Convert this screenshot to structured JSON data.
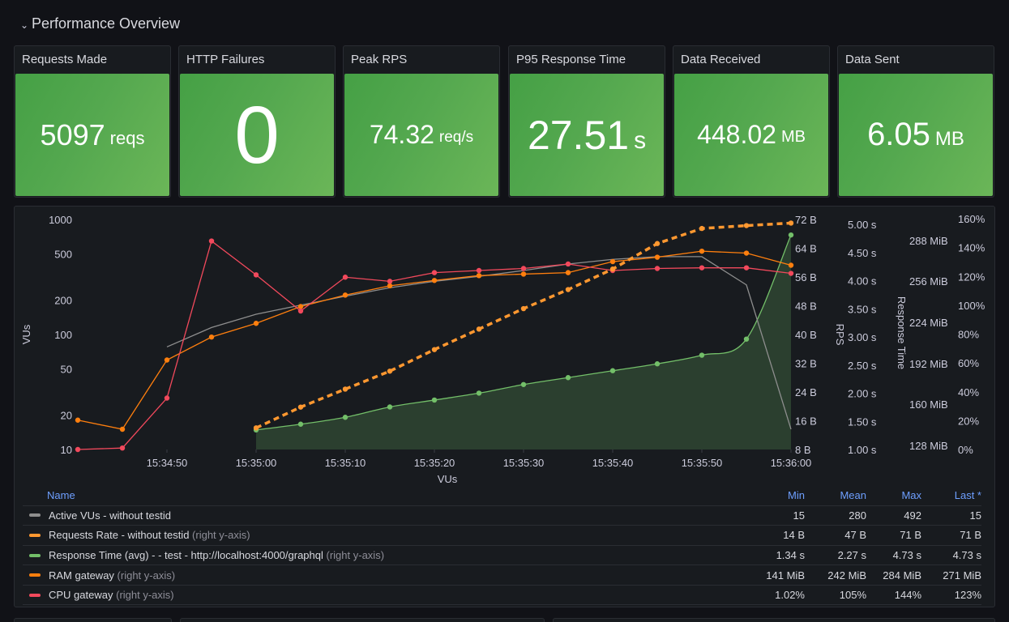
{
  "row": {
    "title": "Performance Overview",
    "collapse_icon": "chevron-down-icon"
  },
  "stats": [
    {
      "title": "Requests Made",
      "value": "5097",
      "unit": "reqs",
      "color": "#56a64b"
    },
    {
      "title": "HTTP Failures",
      "value": "0",
      "unit": "",
      "color": "#56a64b"
    },
    {
      "title": "Peak RPS",
      "value": "74.32",
      "unit": "req/s",
      "color": "#56a64b"
    },
    {
      "title": "P95 Response Time",
      "value": "27.51",
      "unit": "s",
      "color": "#56a64b"
    },
    {
      "title": "Data Received",
      "value": "448.02",
      "unit": "MB",
      "color": "#56a64b"
    },
    {
      "title": "Data Sent",
      "value": "6.05",
      "unit": "MB",
      "color": "#56a64b"
    }
  ],
  "chart_data": {
    "type": "line",
    "title": "",
    "xlabel": "VUs",
    "x_ticks": [
      "15:34:50",
      "15:35:00",
      "15:35:10",
      "15:35:20",
      "15:35:30",
      "15:35:40",
      "15:35:50",
      "15:36:00"
    ],
    "x": [
      "15:34:40",
      "15:34:45",
      "15:34:50",
      "15:34:55",
      "15:35:00",
      "15:35:05",
      "15:35:10",
      "15:35:15",
      "15:35:20",
      "15:35:25",
      "15:35:30",
      "15:35:35",
      "15:35:40",
      "15:35:45",
      "15:35:50",
      "15:35:55",
      "15:36:00"
    ],
    "grid": false,
    "axes": {
      "left": {
        "label": "VUs",
        "scale": "log",
        "ticks": [
          "1000",
          "500",
          "200",
          "100",
          "50",
          "20",
          "10"
        ],
        "range": [
          10,
          1000
        ]
      },
      "right1": {
        "label": "RPS",
        "ticks": [
          "72 B",
          "64 B",
          "56 B",
          "48 B",
          "40 B",
          "32 B",
          "24 B",
          "16 B",
          "8 B"
        ],
        "range": [
          8,
          72
        ]
      },
      "right2": {
        "label": "Response Time",
        "ticks": [
          "5.00 s",
          "4.50 s",
          "4.00 s",
          "3.50 s",
          "3.00 s",
          "2.50 s",
          "2.00 s",
          "1.50 s",
          "1.00 s"
        ],
        "range": [
          1,
          5
        ]
      },
      "right3": {
        "label": "",
        "ticks": [
          "288 MiB",
          "256 MiB",
          "224 MiB",
          "192 MiB",
          "160 MiB",
          "128 MiB"
        ],
        "range": [
          120,
          300
        ]
      },
      "right4": {
        "label": "",
        "ticks": [
          "160%",
          "140%",
          "120%",
          "100%",
          "80%",
          "60%",
          "40%",
          "20%",
          "0%"
        ],
        "range": [
          0,
          160
        ]
      }
    },
    "series": [
      {
        "name": "Active VUs - without testid",
        "color": "#8e8e8e",
        "axis": "left",
        "style": "line",
        "points": false,
        "values": [
          null,
          null,
          78,
          115,
          150,
          180,
          215,
          255,
          290,
          320,
          360,
          410,
          450,
          475,
          475,
          270,
          15
        ]
      },
      {
        "name": "Requests Rate - without testid",
        "color": "#ff9830",
        "axis": "right1",
        "style": "dashed",
        "points": true,
        "values": [
          null,
          null,
          null,
          null,
          14,
          19.8,
          24.8,
          29.8,
          35.8,
          41.5,
          47.2,
          52.5,
          58.2,
          65.3,
          69.5,
          70.3,
          71
        ]
      },
      {
        "name": "Response Time (avg) - - test - http://localhost:4000/graphql",
        "color": "#73bf69",
        "axis": "right2",
        "style": "area",
        "points": true,
        "values": [
          null,
          null,
          null,
          null,
          1.34,
          1.44,
          1.56,
          1.74,
          1.86,
          1.98,
          2.13,
          2.25,
          2.37,
          2.49,
          2.64,
          2.92,
          4.73
        ]
      },
      {
        "name": "RAM gateway",
        "color": "#ff7f0e",
        "axis": "left",
        "style": "line",
        "points": true,
        "values": [
          18,
          15,
          60,
          95,
          125,
          175,
          220,
          265,
          295,
          325,
          335,
          345,
          430,
          470,
          530,
          510,
          400
        ]
      },
      {
        "name": "CPU gateway",
        "color": "#f2495c",
        "axis": "left",
        "style": "line",
        "points": true,
        "values": [
          10,
          10.3,
          28,
          650,
          330,
          160,
          315,
          290,
          345,
          360,
          375,
          410,
          360,
          375,
          380,
          380,
          340
        ]
      }
    ]
  },
  "legend": {
    "headers": {
      "name": "Name",
      "min": "Min",
      "mean": "Mean",
      "max": "Max",
      "last": "Last *"
    },
    "rows": [
      {
        "name": "Active VUs - without testid",
        "hint": "",
        "color": "#8e8e8e",
        "min": "15",
        "mean": "280",
        "max": "492",
        "last": "15"
      },
      {
        "name": "Requests Rate - without testid",
        "hint": "(right y-axis)",
        "color": "#ff9830",
        "min": "14 B",
        "mean": "47 B",
        "max": "71 B",
        "last": "71 B"
      },
      {
        "name": "Response Time (avg) - - test - http://localhost:4000/graphql",
        "hint": "(right y-axis)",
        "color": "#73bf69",
        "min": "1.34 s",
        "mean": "2.27 s",
        "max": "4.73 s",
        "last": "4.73 s"
      },
      {
        "name": "RAM gateway",
        "hint": "(right y-axis)",
        "color": "#ff7f0e",
        "min": "141 MiB",
        "mean": "242 MiB",
        "max": "284 MiB",
        "last": "271 MiB"
      },
      {
        "name": "CPU gateway",
        "hint": "(right y-axis)",
        "color": "#f2495c",
        "min": "1.02%",
        "mean": "105%",
        "max": "144%",
        "last": "123%"
      }
    ]
  }
}
